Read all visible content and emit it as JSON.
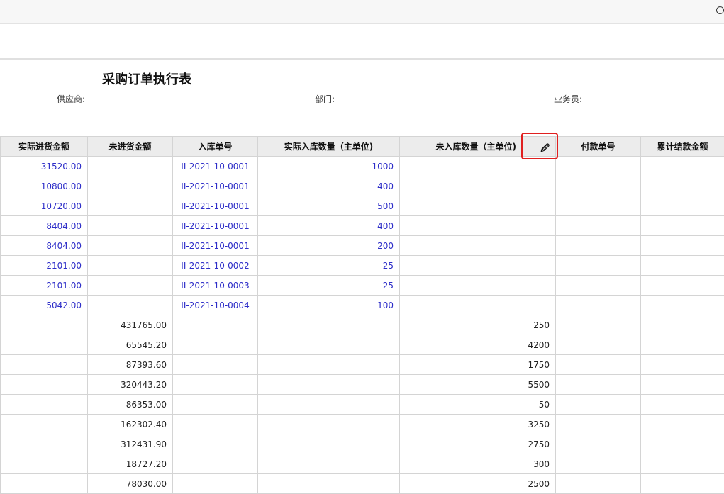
{
  "report": {
    "title": "采购订单执行表",
    "filters": {
      "supplier_label": "供应商:",
      "department_label": "部门:",
      "salesperson_label": "业务员:"
    }
  },
  "table": {
    "headers": [
      "实际进货金额",
      "未进货金额",
      "入库单号",
      "实际入库数量（主单位)",
      "未入库数量（主单位)",
      "付款单号",
      "累计结款金额"
    ],
    "rows": [
      [
        "31520.00",
        "",
        "II-2021-10-0001",
        "1000",
        "",
        "",
        ""
      ],
      [
        "10800.00",
        "",
        "II-2021-10-0001",
        "400",
        "",
        "",
        ""
      ],
      [
        "10720.00",
        "",
        "II-2021-10-0001",
        "500",
        "",
        "",
        ""
      ],
      [
        "8404.00",
        "",
        "II-2021-10-0001",
        "400",
        "",
        "",
        ""
      ],
      [
        "8404.00",
        "",
        "II-2021-10-0001",
        "200",
        "",
        "",
        ""
      ],
      [
        "2101.00",
        "",
        "II-2021-10-0002",
        "25",
        "",
        "",
        ""
      ],
      [
        "2101.00",
        "",
        "II-2021-10-0003",
        "25",
        "",
        "",
        ""
      ],
      [
        "5042.00",
        "",
        "II-2021-10-0004",
        "100",
        "",
        "",
        ""
      ],
      [
        "",
        "431765.00",
        "",
        "",
        "250",
        "",
        ""
      ],
      [
        "",
        "65545.20",
        "",
        "",
        "4200",
        "",
        ""
      ],
      [
        "",
        "87393.60",
        "",
        "",
        "1750",
        "",
        ""
      ],
      [
        "",
        "320443.20",
        "",
        "",
        "5500",
        "",
        ""
      ],
      [
        "",
        "86353.00",
        "",
        "",
        "50",
        "",
        ""
      ],
      [
        "",
        "162302.40",
        "",
        "",
        "3250",
        "",
        ""
      ],
      [
        "",
        "312431.90",
        "",
        "",
        "2750",
        "",
        ""
      ],
      [
        "",
        "18727.20",
        "",
        "",
        "300",
        "",
        ""
      ],
      [
        "",
        "78030.00",
        "",
        "",
        "2500",
        "",
        ""
      ]
    ]
  },
  "icons": {
    "search": "search-icon",
    "pin": "pin-icon"
  },
  "colors": {
    "link_blue": "#2d2dc8",
    "highlight_red": "#e02020",
    "header_bg": "#ececec"
  }
}
